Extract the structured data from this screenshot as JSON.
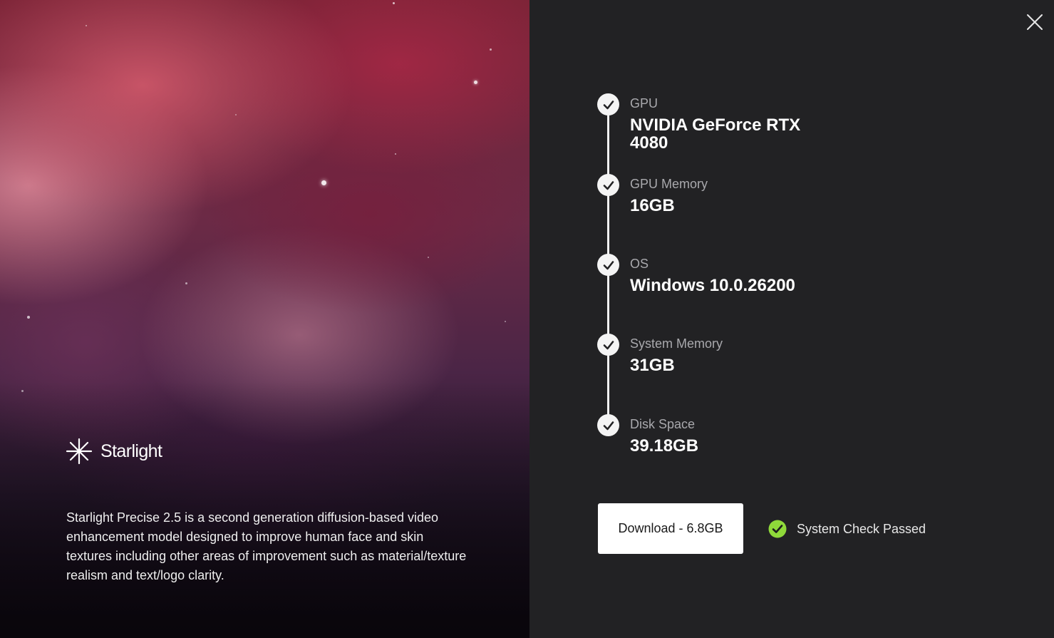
{
  "hero": {
    "brand_name": "Starlight",
    "brand_icon": "starburst-icon",
    "description": "Starlight Precise 2.5 is a second generation diffusion-based video enhancement model designed to improve human face and skin textures including other areas of improvement such as material/texture realism and text/logo clarity."
  },
  "window": {
    "close_icon": "close-icon"
  },
  "system_check": {
    "items": [
      {
        "label": "GPU",
        "value": "NVIDIA GeForce RTX 4080",
        "status": "passed"
      },
      {
        "label": "GPU Memory",
        "value": "16GB",
        "status": "passed"
      },
      {
        "label": "OS",
        "value": "Windows 10.0.26200",
        "status": "passed"
      },
      {
        "label": "System Memory",
        "value": "31GB",
        "status": "passed"
      },
      {
        "label": "Disk Space",
        "value": "39.18GB",
        "status": "passed"
      }
    ],
    "download_label": "Download - 6.8GB",
    "status_text": "System Check Passed",
    "status_color": "#8fd93a"
  },
  "colors": {
    "panel_bg": "#222224",
    "accent_success": "#8fd93a",
    "button_bg": "#ffffff"
  }
}
